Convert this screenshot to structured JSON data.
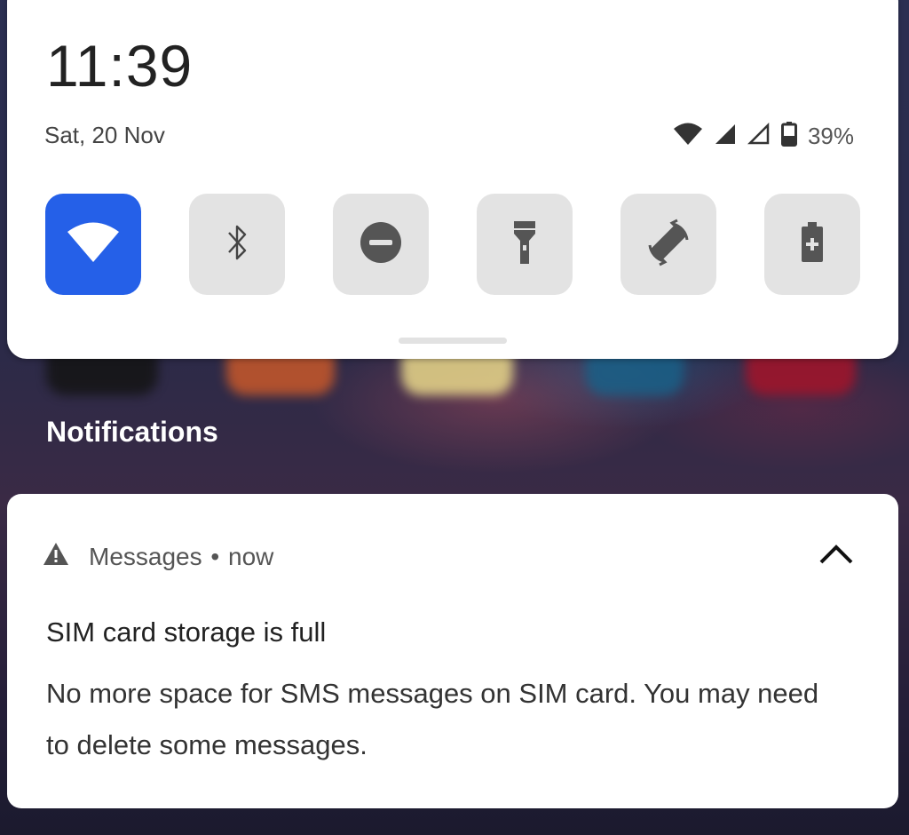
{
  "quick_settings": {
    "time": "11:39",
    "date": "Sat, 20 Nov",
    "battery_percent": "39%",
    "status_icons": [
      "wifi-icon",
      "cell-signal-icon",
      "cell-signal-empty-icon",
      "battery-icon"
    ],
    "tiles": [
      {
        "name": "wifi",
        "icon": "wifi-icon",
        "active": true
      },
      {
        "name": "bluetooth",
        "icon": "bluetooth-icon",
        "active": false
      },
      {
        "name": "do-not-disturb",
        "icon": "do-not-disturb-icon",
        "active": false
      },
      {
        "name": "flashlight",
        "icon": "flashlight-icon",
        "active": false
      },
      {
        "name": "auto-rotate",
        "icon": "rotate-icon",
        "active": false
      },
      {
        "name": "battery-saver",
        "icon": "battery-saver-icon",
        "active": false
      }
    ]
  },
  "notifications_header": "Notifications",
  "notification": {
    "app_name": "Messages",
    "separator": "•",
    "time": "now",
    "title": "SIM card storage is full",
    "body": "No more space for SMS messages on SIM card. You may need to delete some messages."
  },
  "colors": {
    "accent": "#2560e8",
    "tile_inactive": "#e3e3e3"
  }
}
